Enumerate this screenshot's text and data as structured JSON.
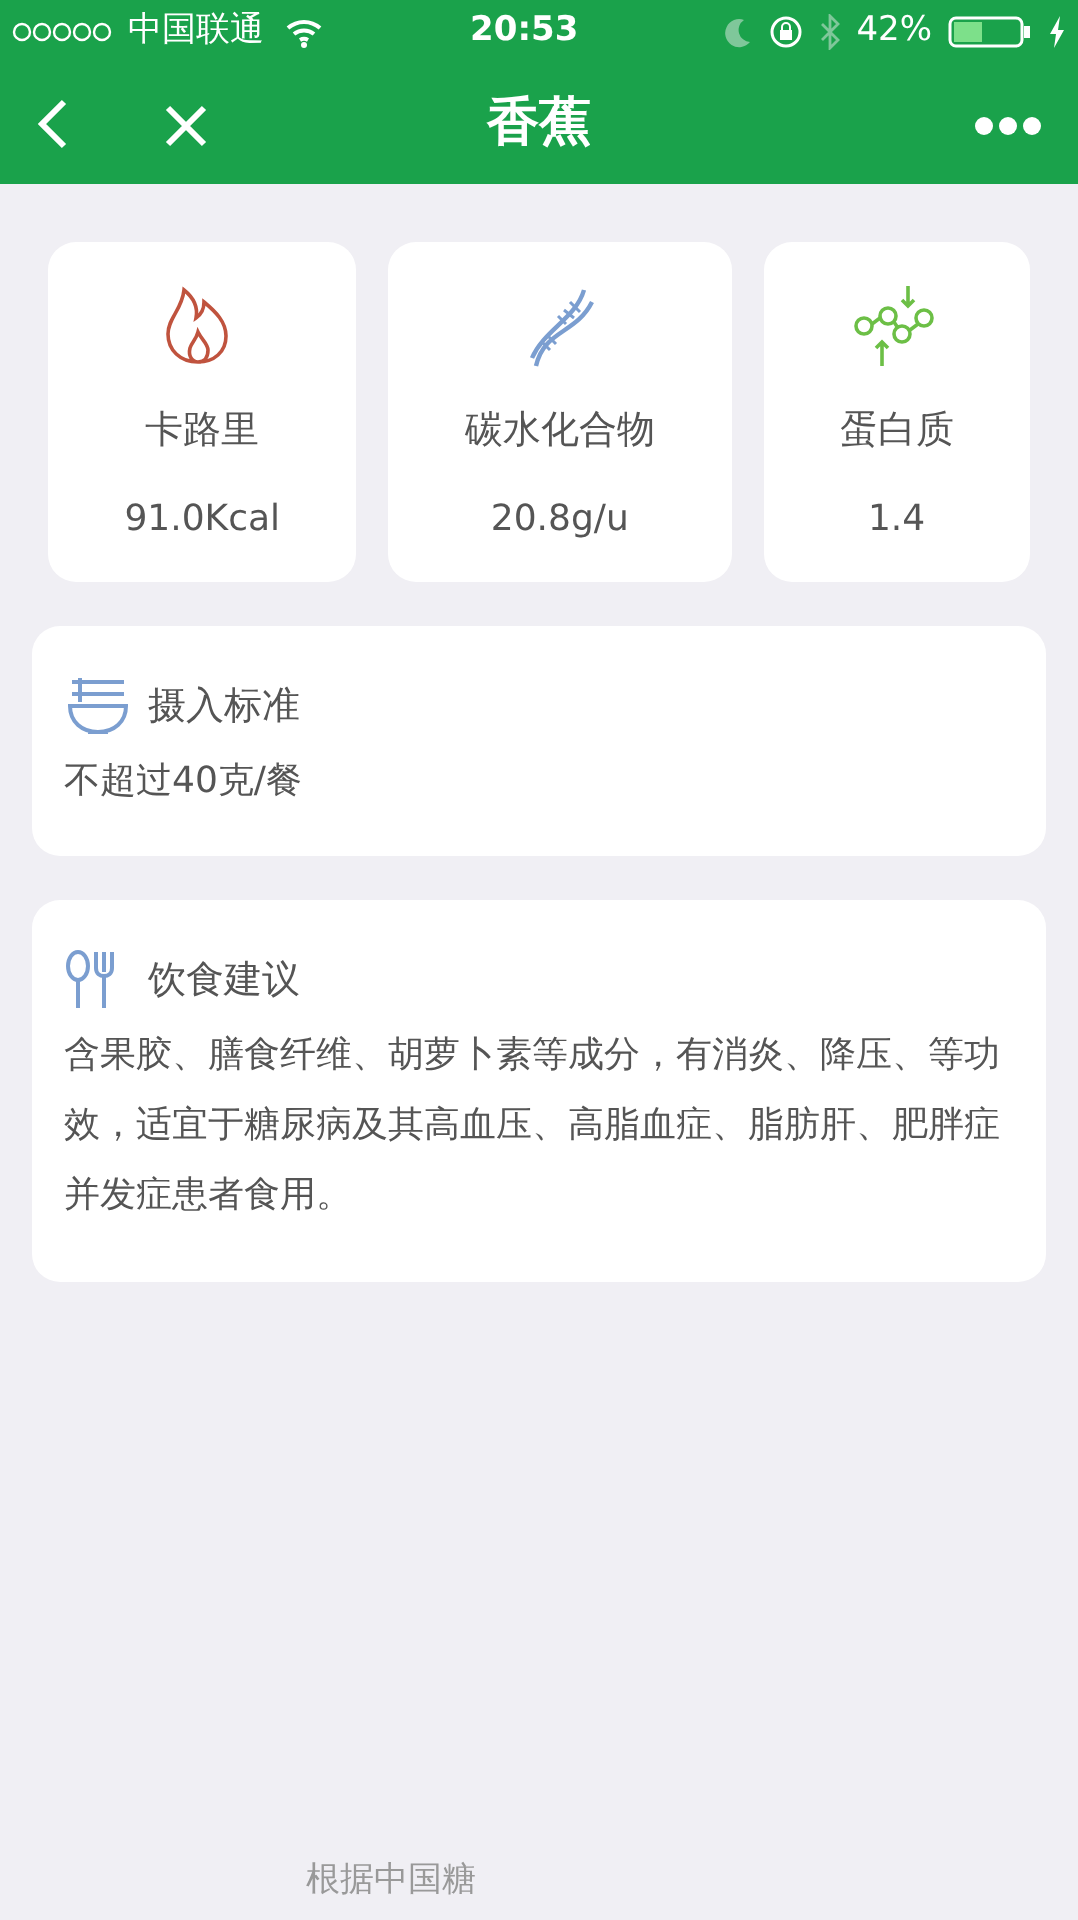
{
  "status_bar": {
    "carrier": "中国联通",
    "time": "20:53",
    "battery": "42%"
  },
  "nav": {
    "title": "香蕉"
  },
  "nutrients": [
    {
      "label": "卡路里",
      "value": "91.0Kcal"
    },
    {
      "label": "碳水化合物",
      "value": "20.8g/u"
    },
    {
      "label": "蛋白质",
      "value": "1.4"
    }
  ],
  "sections": [
    {
      "title": "摄入标准",
      "body": "不超过40克/餐"
    },
    {
      "title": "饮食建议",
      "body": "含果胶、膳食纤维、胡萝卜素等成分，有消炎、降压、等功效，适宜于糖尿病及其高血压、高脂血症、脂肪肝、肥胖症并发症患者食用。"
    }
  ],
  "footer": "根据中国糖"
}
